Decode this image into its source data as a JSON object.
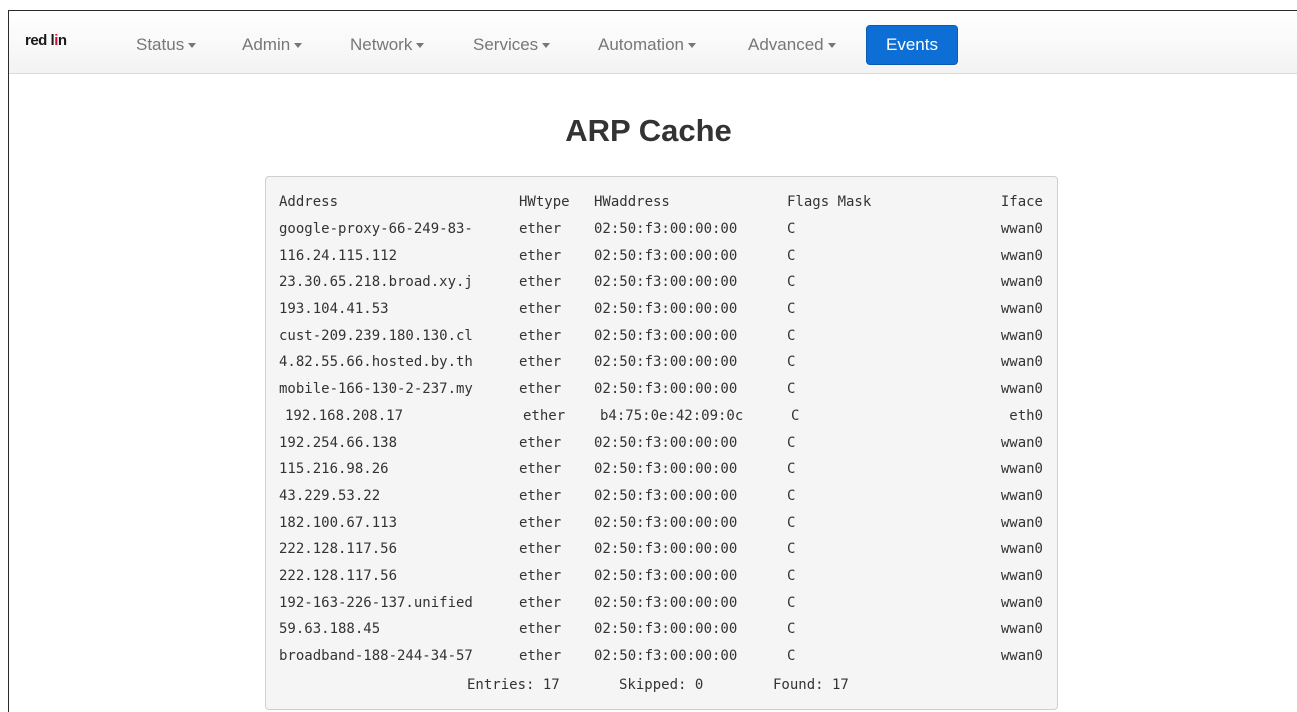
{
  "navbar": {
    "logo_main": "red l",
    "logo_accent": "i",
    "logo_tail": "n",
    "menus": [
      {
        "label": "Status"
      },
      {
        "label": "Admin"
      },
      {
        "label": "Network"
      },
      {
        "label": "Services"
      },
      {
        "label": "Automation"
      },
      {
        "label": "Advanced"
      }
    ],
    "events_label": "Events",
    "events_color": "#0d6fd6"
  },
  "page": {
    "title": "ARP Cache"
  },
  "arp": {
    "headers": {
      "address": "Address",
      "hwtype": "HWtype",
      "hwaddress": "HWaddress",
      "flags_mask": "Flags Mask",
      "iface": "Iface"
    },
    "rows": [
      {
        "address": "google-proxy-66-249-83-",
        "hwtype": "ether",
        "hwaddress": "02:50:f3:00:00:00",
        "flags": "C",
        "iface": "wwan0"
      },
      {
        "address": "116.24.115.112",
        "hwtype": "ether",
        "hwaddress": "02:50:f3:00:00:00",
        "flags": "C",
        "iface": "wwan0"
      },
      {
        "address": "23.30.65.218.broad.xy.j",
        "hwtype": "ether",
        "hwaddress": "02:50:f3:00:00:00",
        "flags": "C",
        "iface": "wwan0"
      },
      {
        "address": "193.104.41.53",
        "hwtype": "ether",
        "hwaddress": "02:50:f3:00:00:00",
        "flags": "C",
        "iface": "wwan0"
      },
      {
        "address": "cust-209.239.180.130.cl",
        "hwtype": "ether",
        "hwaddress": "02:50:f3:00:00:00",
        "flags": "C",
        "iface": "wwan0"
      },
      {
        "address": "4.82.55.66.hosted.by.th",
        "hwtype": "ether",
        "hwaddress": "02:50:f3:00:00:00",
        "flags": "C",
        "iface": "wwan0"
      },
      {
        "address": "mobile-166-130-2-237.my",
        "hwtype": "ether",
        "hwaddress": "02:50:f3:00:00:00",
        "flags": "C",
        "iface": "wwan0"
      },
      {
        "address": "192.168.208.17",
        "hwtype": "ether",
        "hwaddress": "b4:75:0e:42:09:0c",
        "flags": "C",
        "iface": "eth0"
      },
      {
        "address": "192.254.66.138",
        "hwtype": "ether",
        "hwaddress": "02:50:f3:00:00:00",
        "flags": "C",
        "iface": "wwan0"
      },
      {
        "address": "115.216.98.26",
        "hwtype": "ether",
        "hwaddress": "02:50:f3:00:00:00",
        "flags": "C",
        "iface": "wwan0"
      },
      {
        "address": "43.229.53.22",
        "hwtype": "ether",
        "hwaddress": "02:50:f3:00:00:00",
        "flags": "C",
        "iface": "wwan0"
      },
      {
        "address": "182.100.67.113",
        "hwtype": "ether",
        "hwaddress": "02:50:f3:00:00:00",
        "flags": "C",
        "iface": "wwan0"
      },
      {
        "address": "222.128.117.56",
        "hwtype": "ether",
        "hwaddress": "02:50:f3:00:00:00",
        "flags": "C",
        "iface": "wwan0"
      },
      {
        "address": "222.128.117.56",
        "hwtype": "ether",
        "hwaddress": "02:50:f3:00:00:00",
        "flags": "C",
        "iface": "wwan0"
      },
      {
        "address": "192-163-226-137.unified",
        "hwtype": "ether",
        "hwaddress": "02:50:f3:00:00:00",
        "flags": "C",
        "iface": "wwan0"
      },
      {
        "address": "59.63.188.45",
        "hwtype": "ether",
        "hwaddress": "02:50:f3:00:00:00",
        "flags": "C",
        "iface": "wwan0"
      },
      {
        "address": "broadband-188-244-34-57",
        "hwtype": "ether",
        "hwaddress": "02:50:f3:00:00:00",
        "flags": "C",
        "iface": "wwan0"
      }
    ],
    "footer": {
      "entries": "Entries: 17",
      "skipped": "Skipped: 0",
      "found": "Found: 17"
    }
  }
}
